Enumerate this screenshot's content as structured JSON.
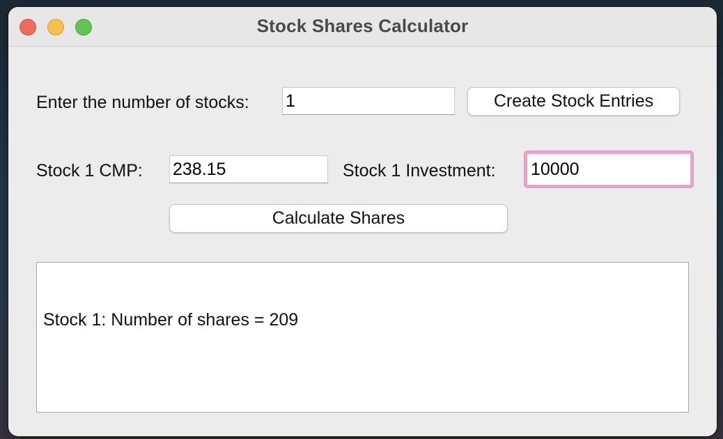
{
  "window": {
    "title": "Stock Shares Calculator"
  },
  "count_row": {
    "label": "Enter the number of stocks:",
    "value": "1",
    "create_button_label": "Create Stock Entries"
  },
  "stocks": [
    {
      "cmp_label": "Stock 1 CMP:",
      "cmp_value": "238.15",
      "investment_label": "Stock 1 Investment:",
      "investment_value": "10000"
    }
  ],
  "calculate_button_label": "Calculate Shares",
  "output": {
    "lines": [
      "Stock 1: Number of shares = 209"
    ]
  },
  "colors": {
    "focus_ring": "#e9a5c9",
    "close": "#ed6a5e",
    "minimize": "#f5bf4f",
    "zoom": "#62c554"
  }
}
